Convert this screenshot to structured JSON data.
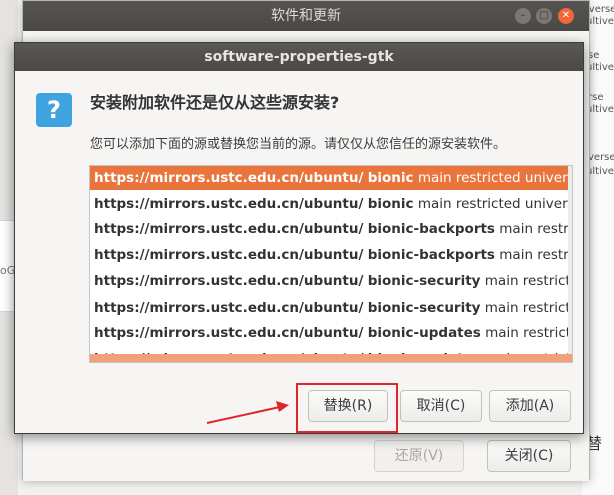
{
  "parent_window": {
    "title": "软件和更新",
    "revert_label": "还原(V)",
    "close_label": "关闭(C)"
  },
  "dialog": {
    "title": "software-properties-gtk",
    "icon": "question-icon",
    "heading": "安装附加软件还是仅从这些源安装?",
    "description": "您可以添加下面的源或替换您当前的源。请仅仅从您信任的源安装软件。",
    "sources": [
      {
        "url": "https://mirrors.ustc.edu.cn/ubuntu/",
        "suite": "bionic",
        "components": "main restricted universe multiverse",
        "selected": true
      },
      {
        "url": "https://mirrors.ustc.edu.cn/ubuntu/",
        "suite": "bionic",
        "components": "main restricted universe multiverse",
        "selected": false
      },
      {
        "url": "https://mirrors.ustc.edu.cn/ubuntu/",
        "suite": "bionic-backports",
        "components": "main restricted universe multiverse",
        "selected": false
      },
      {
        "url": "https://mirrors.ustc.edu.cn/ubuntu/",
        "suite": "bionic-backports",
        "components": "main restricted universe multiverse",
        "selected": false
      },
      {
        "url": "https://mirrors.ustc.edu.cn/ubuntu/",
        "suite": "bionic-security",
        "components": "main restricted universe multiverse",
        "selected": false
      },
      {
        "url": "https://mirrors.ustc.edu.cn/ubuntu/",
        "suite": "bionic-security",
        "components": "main restricted universe multiverse",
        "selected": false
      },
      {
        "url": "https://mirrors.ustc.edu.cn/ubuntu/",
        "suite": "bionic-updates",
        "components": "main restricted universe multiverse",
        "selected": false
      },
      {
        "url": "https://mirrors.ustc.edu.cn/ubuntu/",
        "suite": "bionic-updates",
        "components": "main restricted universe multiverse",
        "selected": false
      }
    ],
    "replace_label": "替换(R)",
    "cancel_label": "取消(C)",
    "add_label": "添加(A)"
  },
  "background": {
    "frag1": "iverse",
    "frag2": "ultiverse",
    "frag3": "se",
    "frag4": "ultiverse",
    "frag5": "rse",
    "frag6": "ultiverse",
    "frag7": "verse",
    "frag8": "ultiver",
    "bottom_text": "的替",
    "left_text": "oG"
  },
  "colors": {
    "selection": "#e9743c",
    "annotation_red": "#e0262a",
    "icon_blue": "#3fa3e0"
  }
}
